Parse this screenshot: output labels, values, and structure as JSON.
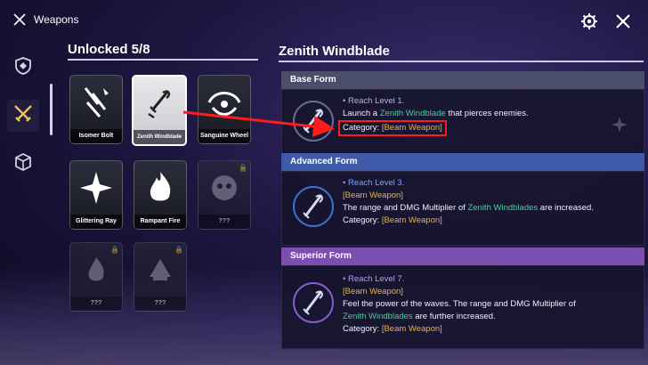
{
  "topbar": {
    "title": "Weapons",
    "settings_icon": "gear-icon",
    "close_icon": "close-icon"
  },
  "sidebar": {
    "tabs": [
      {
        "name": "emblem-tab",
        "icon": "shield-icon"
      },
      {
        "name": "weapons-tab",
        "icon": "crossed-swords-icon",
        "active": true
      },
      {
        "name": "items-tab",
        "icon": "cube-icon"
      }
    ]
  },
  "weapons_list": {
    "title": "Unlocked 5/8",
    "items": [
      {
        "name": "Isomer Bolt",
        "selected": false,
        "locked": false
      },
      {
        "name": "Zenith Windblade",
        "selected": true,
        "locked": false
      },
      {
        "name": "Sanguine Wheel",
        "selected": false,
        "locked": false
      },
      {
        "name": "Glittering Ray",
        "selected": false,
        "locked": false
      },
      {
        "name": "Rampant Fire",
        "selected": false,
        "locked": false
      },
      {
        "name": "???",
        "selected": false,
        "locked": true
      },
      {
        "name": "???",
        "selected": false,
        "locked": true
      },
      {
        "name": "???",
        "selected": false,
        "locked": true
      }
    ]
  },
  "detail": {
    "title": "Zenith Windblade",
    "base": {
      "header": "Base Form",
      "req": "• Reach Level 1.",
      "desc_a": "Launch a ",
      "desc_b": "Zenith Windblade",
      "desc_c": " that pierces enemies.",
      "cat_label": "Category: ",
      "cat_value": "[Beam Weapon]"
    },
    "advanced": {
      "header": "Advanced Form",
      "req": "• Reach Level 3.",
      "tag": "[Beam Weapon]",
      "desc_a": "The range and DMG Multiplier of ",
      "desc_b": "Zenith Windblades",
      "desc_c": " are increased.",
      "cat_label": "Category: ",
      "cat_value": "[Beam Weapon]"
    },
    "superior": {
      "header": "Superior Form",
      "req": "• Reach Level 7.",
      "tag": "[Beam Weapon]",
      "desc_a": "Feel the power of the waves. The range and DMG Multiplier of",
      "desc_b": "Zenith Windblades",
      "desc_c": " are further increased.",
      "cat_label": "Category: ",
      "cat_value": "[Beam Weapon]"
    }
  },
  "colors": {
    "accent_gold": "#e6b152",
    "accent_green": "#3fd29a",
    "highlight_red": "#ff1b1b",
    "base_header": "#4a4e6a",
    "advanced_header": "#3f5aa8",
    "superior_header": "#7a4fb0"
  }
}
